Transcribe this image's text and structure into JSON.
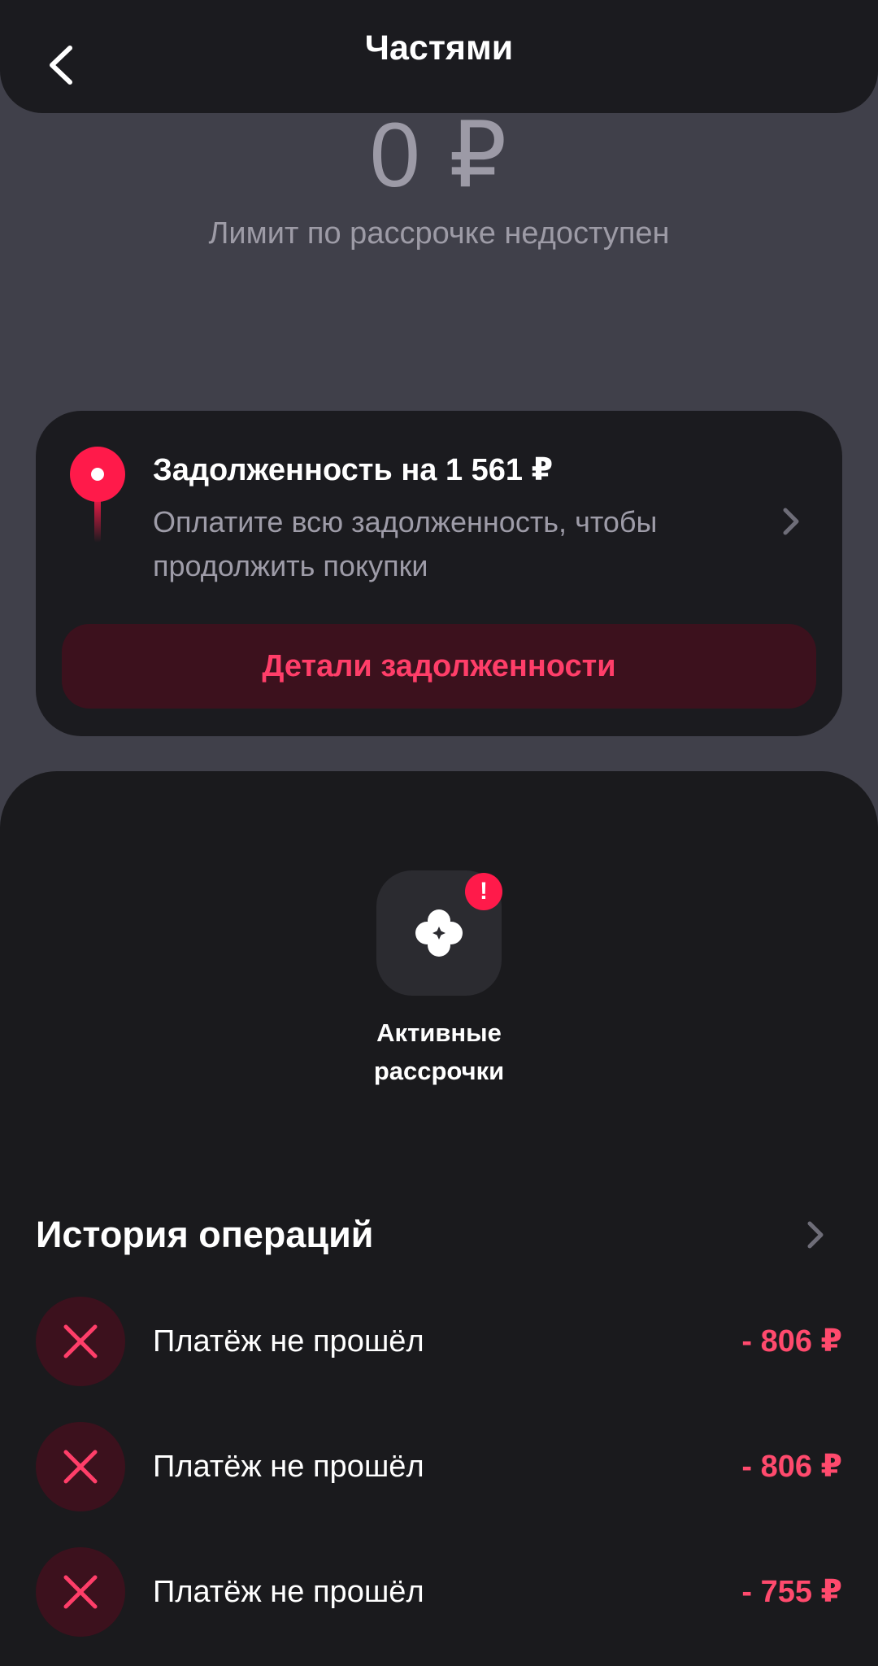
{
  "header": {
    "title": "Частями"
  },
  "limit": {
    "amount": "0 ₽",
    "caption": "Лимит по рассрочке недоступен"
  },
  "debt_card": {
    "title": "Задолженность на 1 561 ₽",
    "text": "Оплатите всю задолженность, чтобы продолжить покупки",
    "button_label": "Детали задолженности"
  },
  "active_tile": {
    "label": "Активные рассрочки",
    "badge": "!"
  },
  "history": {
    "title": "История операций",
    "items": [
      {
        "label": "Платёж не прошёл",
        "amount": "- 806 ₽"
      },
      {
        "label": "Платёж не прошёл",
        "amount": "- 806 ₽"
      },
      {
        "label": "Платёж не прошёл",
        "amount": "- 755 ₽"
      }
    ]
  },
  "colors": {
    "accent": "#ff1a4a",
    "panel": "#1b1b1f",
    "background": "#40404a",
    "danger_bg": "#3c111d"
  },
  "icons": [
    "back-arrow-icon",
    "pin-icon",
    "chevron-right-icon",
    "clover-icon",
    "alert-badge-icon",
    "close-cross-icon"
  ]
}
